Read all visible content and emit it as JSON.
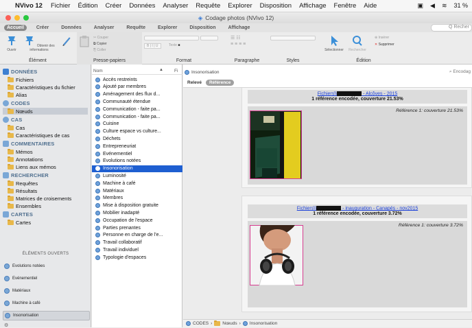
{
  "menubar": {
    "app_name": "NVivo 12",
    "items": [
      "Fichier",
      "Édition",
      "Créer",
      "Données",
      "Analyser",
      "Requête",
      "Explorer",
      "Disposition",
      "Affichage",
      "Fenêtre",
      "Aide"
    ],
    "battery": "31 %"
  },
  "window": {
    "title": "Codage photos (NVivo 12)"
  },
  "ribbon": {
    "tabs": [
      "Accueil",
      "Créer",
      "Données",
      "Analyser",
      "Requête",
      "Explorer",
      "Disposition",
      "Affichage"
    ],
    "active_tab": "Accueil",
    "search_placeholder": "Q Recher",
    "groups": {
      "element": {
        "label": "Élément",
        "ouvrir": "Ouvrir",
        "infos": "Obtenir des informations"
      },
      "presse": {
        "label": "Presse-papiers",
        "couper": "Couper",
        "copier": "Copier",
        "coller": "Coller"
      },
      "format": {
        "label": "Format",
        "texte": "Texte",
        "bold": "B",
        "italic": "I",
        "underline": "U"
      },
      "paragraphe": {
        "label": "Paragraphe"
      },
      "styles": {
        "label": "Styles"
      },
      "edition": {
        "label": "Édition",
        "selectionner": "Sélectionner",
        "rechercher": "Rechercher",
        "insert": "Insérer",
        "supprimer": "Supprimer"
      }
    }
  },
  "nav": {
    "donnees": {
      "title": "DONNÉES",
      "items": [
        "Fichiers",
        "Caractéristiques du fichier",
        "Alias"
      ]
    },
    "codes": {
      "title": "CODES",
      "items": [
        "Nœuds"
      ]
    },
    "cas": {
      "title": "CAS",
      "items": [
        "Cas",
        "Caractéristiques de cas"
      ]
    },
    "commentaires": {
      "title": "COMMENTAIRES",
      "items": [
        "Mémos",
        "Annotations",
        "Liens aux mémos"
      ]
    },
    "rechercher": {
      "title": "RECHERCHER",
      "items": [
        "Requêtes",
        "Résultats",
        "Matrices de croisements",
        "Ensembles"
      ]
    },
    "cartes": {
      "title": "CARTES",
      "items": [
        "Cartes"
      ]
    },
    "opened_title": "ÉLÉMENTS OUVERTS",
    "opened": [
      "Evolutions notées",
      "Evénementiel",
      "Matériaux",
      "Machine à café",
      "Insonorisation"
    ],
    "opened_selected": "Insonorisation"
  },
  "nodes": {
    "col_name": "Nom",
    "col_files": "Fi",
    "items": [
      "Accès restreints",
      "Ajouté par membres",
      "Aménagement des flux d...",
      "Communauté étendue",
      "Communication - faite pa...",
      "Communication - faite pa...",
      "Cuisine",
      "Culture espace vs culture...",
      "Déchets",
      "Entrepreneuriat",
      "Evénementiel",
      "Evolutions notées",
      "Insonorisation",
      "Luminosité",
      "Machine à café",
      "Matériaux",
      "Membres",
      "Mise à disposition gratuite",
      "Mobilier inadapté",
      "Occupation de l'espace",
      "Parties prenantes",
      "Personne en charge de l'e...",
      "Travail collaboratif",
      "Travail individuel",
      "Typologie d'espaces"
    ],
    "selected": "Insonorisation"
  },
  "main": {
    "node_title": "Insonorisation",
    "encoding_label": "Encodag",
    "tabs": [
      "Relevé",
      "Référence"
    ],
    "active_tab": "Référence",
    "refs": [
      {
        "link_prefix": "Fichiers\\\\",
        "link_suffix": " - Alcôves - 2015",
        "summary": "1 référence encodée, couverture 21.53%",
        "ref_line": "Référence 1: couverture 21.53%"
      },
      {
        "link_prefix": "Fichiers\\\\",
        "link_suffix": " - inauguration - Canapés - nov2015",
        "summary": "1 référence encodée, couverture 3.72%",
        "ref_line": "Référence 1: couverture 3.72%"
      }
    ],
    "breadcrumb": [
      "CODES",
      "Nœuds",
      "Insonorisation"
    ]
  },
  "colors": {
    "selection": "#1e5fd1",
    "link": "#1a3fd9",
    "photo_border": "#d63c8f",
    "node_icon": "#6fa2db"
  }
}
